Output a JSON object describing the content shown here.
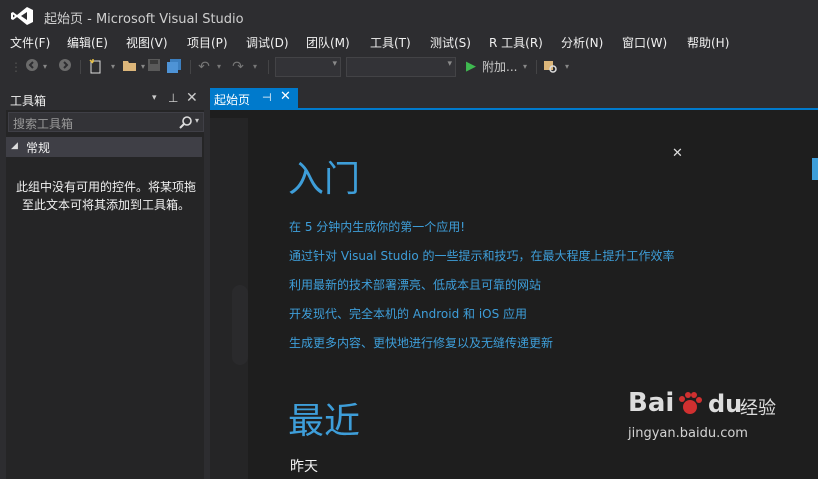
{
  "window": {
    "title": "起始页 - Microsoft Visual Studio"
  },
  "menu": [
    "文件(F)",
    "编辑(E)",
    "视图(V)",
    "项目(P)",
    "调试(D)",
    "团队(M)",
    "工具(T)",
    "测试(S)",
    "R 工具(R)",
    "分析(N)",
    "窗口(W)",
    "帮助(H)"
  ],
  "toolbar": {
    "run_label": "附加..."
  },
  "toolbox": {
    "title": "工具箱",
    "search_placeholder": "搜索工具箱",
    "group_label": "常规",
    "empty_message": "此组中没有可用的控件。将某项拖至此文本可将其添加到工具箱。"
  },
  "tab": {
    "label": "起始页"
  },
  "start_page": {
    "get_started_heading": "入门",
    "links": [
      "在 5 分钟内生成你的第一个应用!",
      "通过针对 Visual Studio 的一些提示和技巧，在最大程度上提升工作效率",
      "利用最新的技术部署漂亮、低成本且可靠的网站",
      "开发现代、完全本机的 Android 和 iOS 应用",
      "生成更多内容、更快地进行修复以及无缝传递更新"
    ],
    "recent_heading": "最近",
    "recent_group": "昨天"
  },
  "watermark": {
    "brand": "Bai",
    "brand2": "du",
    "suffix": "经验",
    "url": "jingyan.baidu.com"
  },
  "colors": {
    "accent": "#007acc",
    "link": "#3e9ed9",
    "background": "#2d2d30",
    "editor": "#1e1e1e"
  }
}
